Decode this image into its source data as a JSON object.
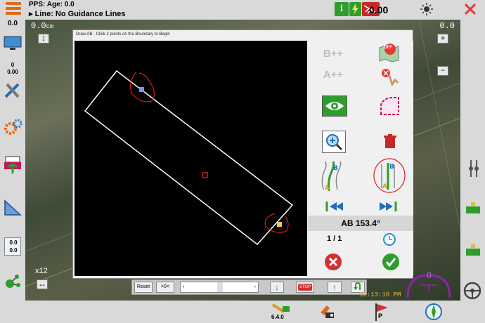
{
  "status": {
    "pps_age": "PPS: Age: 0.0",
    "line_label": "Line: No Guidance Lines",
    "speed": "0.00"
  },
  "map": {
    "offset_left": "0.0",
    "offset_left_unit": "cm",
    "offset_right": "0.0",
    "zoom_label": "x12",
    "clock": "12:13:16 PM",
    "speed_gauge": "0"
  },
  "left_panel": {
    "top_value": "0.0",
    "mid_value_top": "0",
    "mid_value_bottom": "0.00",
    "bottom_value_top": "0.0",
    "bottom_value_bottom": "0.0"
  },
  "dialog": {
    "title": "Draw AB - Click 2 points on the Boundary to Begin",
    "heading_value": "AB 153.4°",
    "page_index": "1 / 1",
    "b_plus_label": "B++",
    "a_plus_label": "A++",
    "off_label": "OFF"
  },
  "toolbar": {
    "reset_label": "Reset",
    "nudge_label": ">0<",
    "stop_label": "STOP",
    "left_arrow": "‹",
    "right_arrow": "›"
  },
  "bottom": {
    "version": "6.4.0",
    "p_label": "P"
  },
  "colors": {
    "panel_bg": "#d9d9d9",
    "accent_orange": "#e06a1a",
    "green": "#2e9d2e",
    "red": "#d32f2f"
  }
}
